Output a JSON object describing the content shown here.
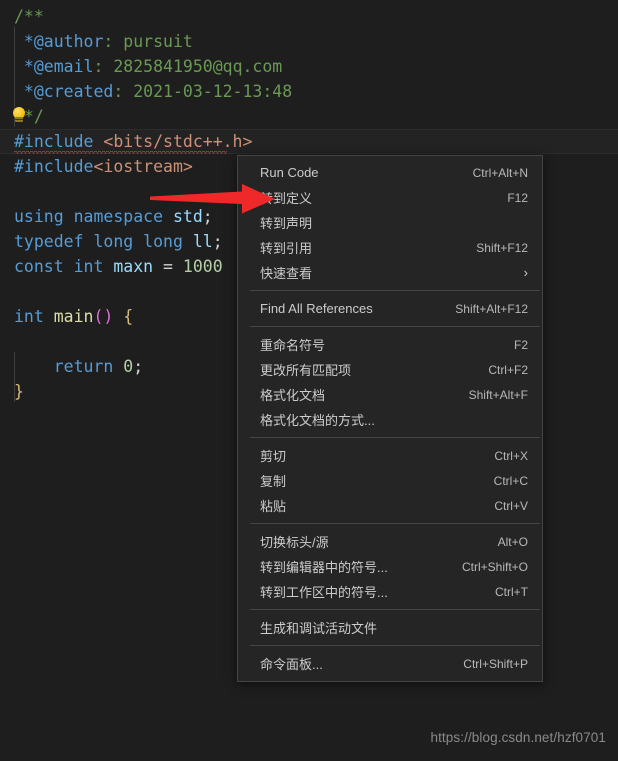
{
  "editor": {
    "background": "#1e1e1e",
    "current_line_background": "#232323",
    "lines": [
      {
        "id": "l1",
        "text": "/**"
      },
      {
        "id": "l2",
        "text": " *@author: pursuit"
      },
      {
        "id": "l3",
        "text": " *@email: 2825841950@qq.com"
      },
      {
        "id": "l4",
        "text": " *@created: 2021-03-12-13:48"
      },
      {
        "id": "l5",
        "text": " */"
      },
      {
        "id": "l6",
        "text": "#include <bits/stdc++.h>"
      },
      {
        "id": "l7",
        "text": "#include<iostream>"
      },
      {
        "id": "l8",
        "text": ""
      },
      {
        "id": "l9",
        "text": "using namespace std;"
      },
      {
        "id": "l10",
        "text": "typedef long long ll;"
      },
      {
        "id": "l11",
        "text": "const int maxn = 1000"
      },
      {
        "id": "l12",
        "text": ""
      },
      {
        "id": "l13",
        "text": "int main() {"
      },
      {
        "id": "l14",
        "text": ""
      },
      {
        "id": "l15",
        "text": "    return 0;"
      },
      {
        "id": "l16",
        "text": "}"
      }
    ],
    "tokens": {
      "comment_open": "/**",
      "author_tag": " *@author",
      "author_sep": ": ",
      "author_value": "pursuit",
      "email_tag": " *@email",
      "email_sep": ": ",
      "email_value": "2825841950@qq.com",
      "created_tag": " *@created",
      "created_sep": ": ",
      "created_value": "2021-03-12-13:48",
      "comment_close": " */",
      "include_kw_1": "#include",
      "include_path_1": " <bits/stdc++.h>",
      "include_kw_2": "#include",
      "include_path_2": "<iostream>",
      "using_kw": "using",
      "namespace_kw": " namespace",
      "std_ident": " std",
      "semicolon_1": ";",
      "typedef_kw": "typedef",
      "long_kw_1": " long",
      "long_kw_2": " long",
      "ll_ident": " ll",
      "semicolon_2": ";",
      "const_kw": "const",
      "int_kw_1": " int",
      "maxn_ident": " maxn",
      "equals": " = ",
      "maxn_value": "1000",
      "int_kw_2": "int",
      "main_fn": " main",
      "main_parens": "()",
      "main_brace_open": " {",
      "return_kw": "    return",
      "return_value": " 0",
      "semicolon_3": ";",
      "main_brace_close": "}"
    },
    "bulb_icon": "lightbulb-quickfix-icon",
    "squiggly": "error-squiggly-underline"
  },
  "annotation": {
    "arrow_color": "#ef2929",
    "arrow_name": "red-pointer-arrow",
    "points_at": "转到定义"
  },
  "context_menu": {
    "groups": [
      {
        "items": [
          {
            "label": "Run Code",
            "shortcut": "Ctrl+Alt+N",
            "name": "menu-item-run-code"
          },
          {
            "label": "转到定义",
            "shortcut": "F12",
            "name": "menu-item-go-to-definition"
          },
          {
            "label": "转到声明",
            "shortcut": "",
            "name": "menu-item-go-to-declaration"
          },
          {
            "label": "转到引用",
            "shortcut": "Shift+F12",
            "name": "menu-item-go-to-references"
          },
          {
            "label": "快速查看",
            "shortcut": "",
            "submenu": "›",
            "name": "menu-item-peek"
          }
        ]
      },
      {
        "items": [
          {
            "label": "Find All References",
            "shortcut": "Shift+Alt+F12",
            "name": "menu-item-find-all-references"
          }
        ]
      },
      {
        "items": [
          {
            "label": "重命名符号",
            "shortcut": "F2",
            "name": "menu-item-rename-symbol"
          },
          {
            "label": "更改所有匹配项",
            "shortcut": "Ctrl+F2",
            "name": "menu-item-change-all-occurrences"
          },
          {
            "label": "格式化文档",
            "shortcut": "Shift+Alt+F",
            "name": "menu-item-format-document"
          },
          {
            "label": "格式化文档的方式...",
            "shortcut": "",
            "name": "menu-item-format-document-with"
          }
        ]
      },
      {
        "items": [
          {
            "label": "剪切",
            "shortcut": "Ctrl+X",
            "name": "menu-item-cut"
          },
          {
            "label": "复制",
            "shortcut": "Ctrl+C",
            "name": "menu-item-copy"
          },
          {
            "label": "粘贴",
            "shortcut": "Ctrl+V",
            "name": "menu-item-paste"
          }
        ]
      },
      {
        "items": [
          {
            "label": "切换标头/源",
            "shortcut": "Alt+O",
            "name": "menu-item-switch-header-source"
          },
          {
            "label": "转到编辑器中的符号...",
            "shortcut": "Ctrl+Shift+O",
            "name": "menu-item-go-to-symbol-in-editor"
          },
          {
            "label": "转到工作区中的符号...",
            "shortcut": "Ctrl+T",
            "name": "menu-item-go-to-symbol-in-workspace"
          }
        ]
      },
      {
        "items": [
          {
            "label": "生成和调试活动文件",
            "shortcut": "",
            "name": "menu-item-build-and-debug-active-file"
          }
        ]
      },
      {
        "items": [
          {
            "label": "命令面板...",
            "shortcut": "Ctrl+Shift+P",
            "name": "menu-item-command-palette"
          }
        ]
      }
    ]
  },
  "watermark": {
    "text": "https://blog.csdn.net/hzf0701"
  }
}
